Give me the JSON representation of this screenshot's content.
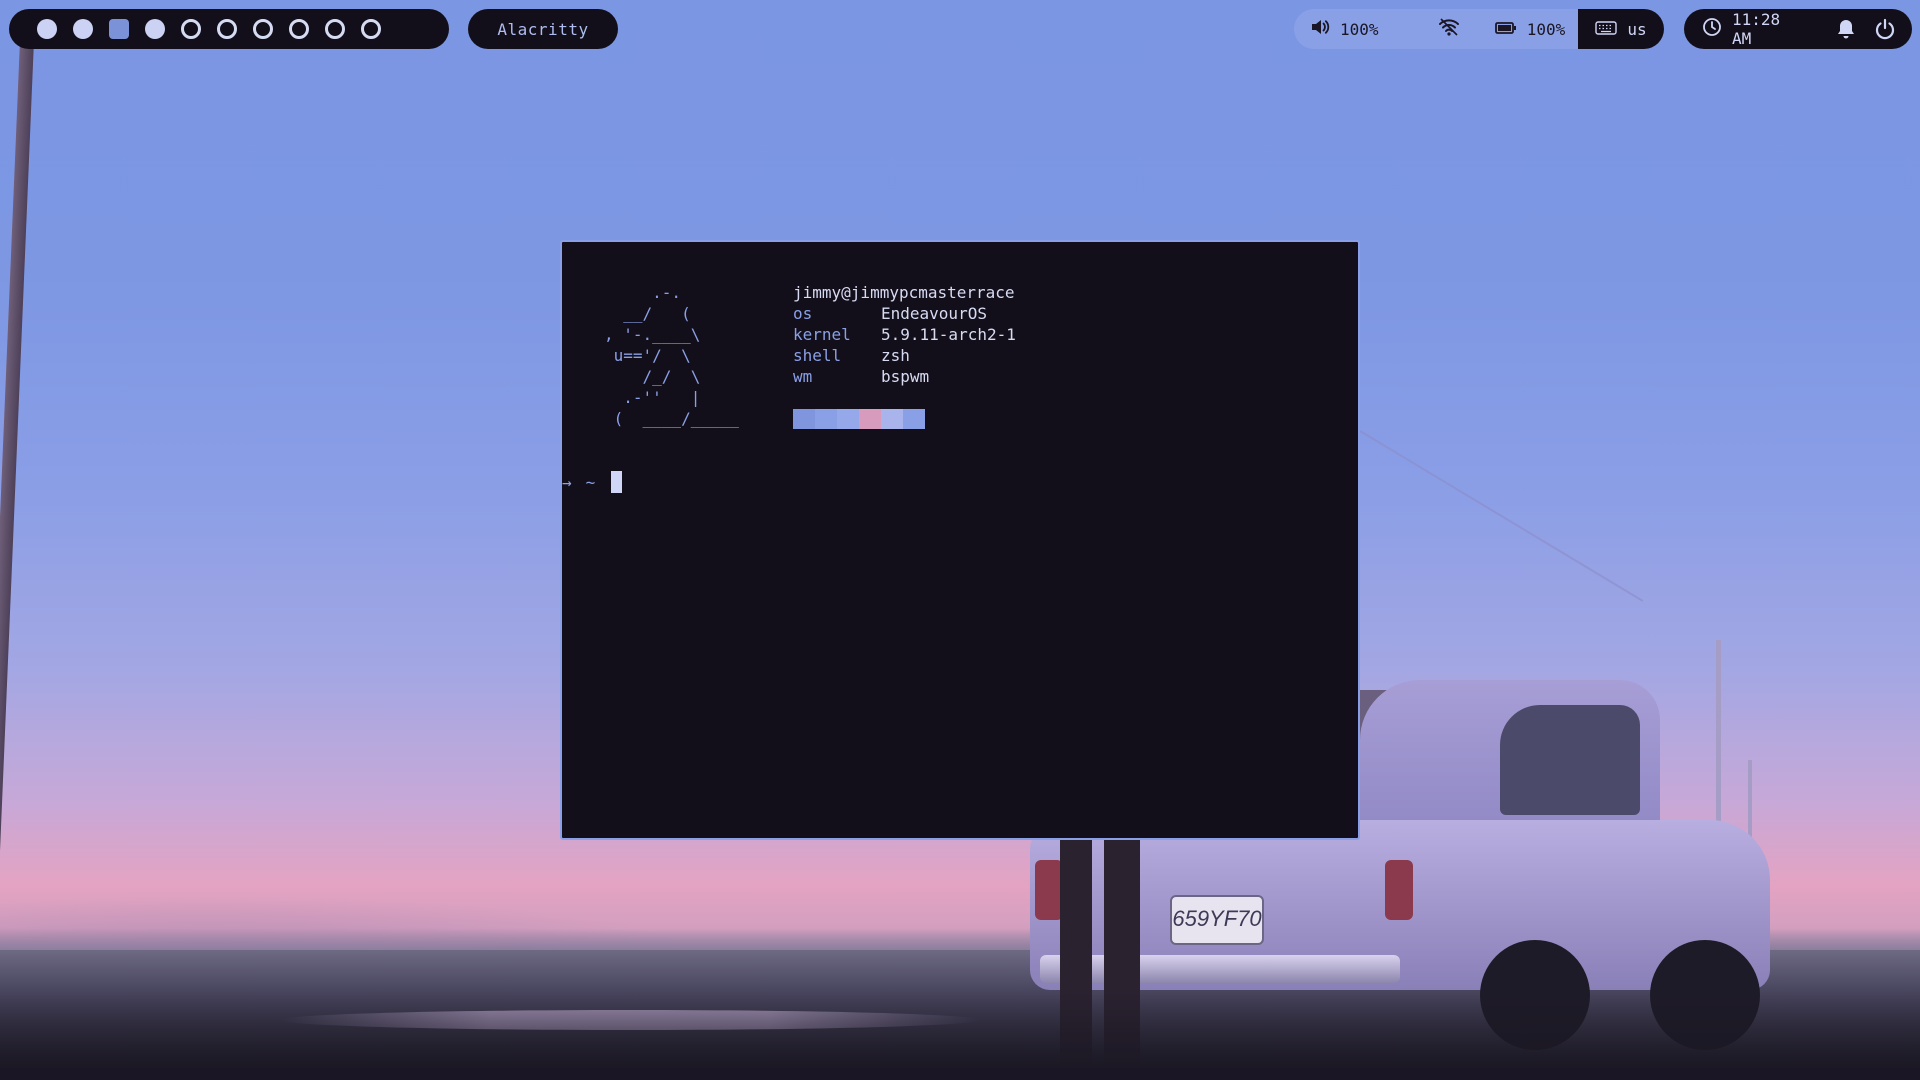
{
  "bar": {
    "workspaces": [
      {
        "state": "filled"
      },
      {
        "state": "filled"
      },
      {
        "state": "active"
      },
      {
        "state": "filled"
      },
      {
        "state": "empty"
      },
      {
        "state": "empty"
      },
      {
        "state": "empty"
      },
      {
        "state": "empty"
      },
      {
        "state": "empty"
      },
      {
        "state": "empty"
      }
    ],
    "window_title": "Alacritty",
    "volume": {
      "icon": "speaker-icon",
      "value": "100%"
    },
    "wifi": {
      "icon": "wifi-icon"
    },
    "battery": {
      "icon": "battery-icon",
      "value": "100%"
    },
    "keyboard": {
      "icon": "keyboard-icon",
      "layout": "us"
    },
    "clock": {
      "icon": "clock-icon",
      "time": "11:28 AM"
    },
    "notifications": {
      "icon": "bell-icon"
    },
    "power": {
      "icon": "power-icon"
    }
  },
  "terminal": {
    "ascii_art": "     .-.\n  __/   (\n, '-.____\\\n u=='/  \\\n    /_/  \\\n  .-''   |\n (  ____/_____",
    "user_host": "jimmy@jimmypcmasterrace",
    "info": [
      {
        "key": "os",
        "value": "EndeavourOS"
      },
      {
        "key": "kernel",
        "value": "5.9.11-arch2-1"
      },
      {
        "key": "shell",
        "value": "zsh"
      },
      {
        "key": "wm",
        "value": "bspwm"
      }
    ],
    "swatches": [
      "#7f95de",
      "#8aa0e6",
      "#94a8ea",
      "#d79bbd",
      "#a9b3ec",
      "#8aa0e6"
    ],
    "prompt_arrow": "→",
    "prompt_dir": "~"
  },
  "wallpaper": {
    "license_plate": "659YF70"
  },
  "colors": {
    "accent": "#8aa0e6",
    "bar_bg": "#130f1a",
    "text": "#d6dbf3"
  }
}
